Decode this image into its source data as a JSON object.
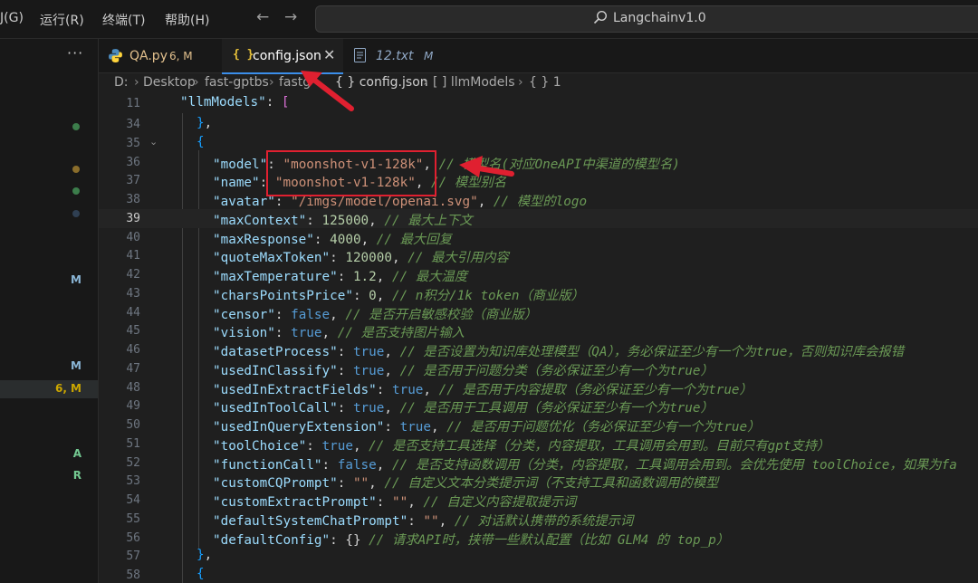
{
  "menu": [
    "运行(R)",
    "终端(T)",
    "帮助(H)"
  ],
  "menu_partial": "J(G)",
  "command_center": {
    "label": "Langchainv1.0",
    "icon": "search-icon"
  },
  "side_panel": {
    "badges": [
      {
        "text": "M",
        "color": "#8ab6d6"
      },
      {
        "text": "M",
        "color": "#8ab6d6"
      },
      {
        "text": "6, M",
        "color": "#cca700"
      },
      {
        "text": "A",
        "color": "#73c991"
      },
      {
        "text": "R",
        "color": "#73c991"
      }
    ],
    "dots": [
      {
        "color": "#3c7d4b"
      },
      {
        "color": "#8a6d2b"
      },
      {
        "color": "#3c7d4b"
      },
      {
        "color": "#2f3f52"
      }
    ]
  },
  "tabs": [
    {
      "label": "QA.py",
      "status": "6, M",
      "icon": "python-icon"
    },
    {
      "label": "config.json",
      "status": "",
      "icon": "json-braces-icon",
      "active": true
    },
    {
      "label": "12.txt",
      "status": "M",
      "icon": "text-file-icon"
    }
  ],
  "breadcrumb": [
    "D:",
    "Desktop",
    "fast-gptbs",
    "fastg",
    "{ } config.json",
    "[ ] llmModels",
    "{ } 1"
  ],
  "editor": {
    "current_line": "39",
    "sticky_line": {
      "num": "11",
      "key": "\"llmModels\"",
      "rest": ": ["
    },
    "lines": [
      {
        "num": "34",
        "text": "},"
      },
      {
        "num": "35",
        "text": "{"
      },
      {
        "num": "36",
        "key": "\"model\"",
        "val": "\"moonshot-v1-128k\"",
        "vtype": "s",
        "comment": "// 模型名(对应OneAPI中渠道的模型名)"
      },
      {
        "num": "37",
        "key": "\"name\"",
        "val": "\"moonshot-v1-128k\"",
        "vtype": "s",
        "comment": "// 模型别名"
      },
      {
        "num": "38",
        "key": "\"avatar\"",
        "val": "\"/imgs/model/openai.svg\"",
        "vtype": "s",
        "comment": "// 模型的logo"
      },
      {
        "num": "39",
        "key": "\"maxContext\"",
        "val": "125000",
        "vtype": "n",
        "comment": "// 最大上下文"
      },
      {
        "num": "40",
        "key": "\"maxResponse\"",
        "val": "4000",
        "vtype": "n",
        "comment": "// 最大回复"
      },
      {
        "num": "41",
        "key": "\"quoteMaxToken\"",
        "val": "120000",
        "vtype": "n",
        "comment": "// 最大引用内容"
      },
      {
        "num": "42",
        "key": "\"maxTemperature\"",
        "val": "1.2",
        "vtype": "n",
        "comment": "// 最大温度"
      },
      {
        "num": "43",
        "key": "\"charsPointsPrice\"",
        "val": "0",
        "vtype": "n",
        "comment": "// n积分/1k token（商业版）"
      },
      {
        "num": "44",
        "key": "\"censor\"",
        "val": "false",
        "vtype": "b",
        "comment": "// 是否开启敏感校验（商业版）"
      },
      {
        "num": "45",
        "key": "\"vision\"",
        "val": "true",
        "vtype": "b",
        "comment": "// 是否支持图片输入"
      },
      {
        "num": "46",
        "key": "\"datasetProcess\"",
        "val": "true",
        "vtype": "b",
        "comment": "// 是否设置为知识库处理模型（QA），务必保证至少有一个为true，否则知识库会报错"
      },
      {
        "num": "47",
        "key": "\"usedInClassify\"",
        "val": "true",
        "vtype": "b",
        "comment": "// 是否用于问题分类（务必保证至少有一个为true）"
      },
      {
        "num": "48",
        "key": "\"usedInExtractFields\"",
        "val": "true",
        "vtype": "b",
        "comment": "// 是否用于内容提取（务必保证至少有一个为true）"
      },
      {
        "num": "49",
        "key": "\"usedInToolCall\"",
        "val": "true",
        "vtype": "b",
        "comment": "// 是否用于工具调用（务必保证至少有一个为true）"
      },
      {
        "num": "50",
        "key": "\"usedInQueryExtension\"",
        "val": "true",
        "vtype": "b",
        "comment": "// 是否用于问题优化（务必保证至少有一个为true）"
      },
      {
        "num": "51",
        "key": "\"toolChoice\"",
        "val": "true",
        "vtype": "b",
        "comment": "// 是否支持工具选择（分类，内容提取，工具调用会用到。目前只有gpt支持）"
      },
      {
        "num": "52",
        "key": "\"functionCall\"",
        "val": "false",
        "vtype": "b",
        "comment": "// 是否支持函数调用（分类，内容提取，工具调用会用到。会优先使用 toolChoice，如果为fa"
      },
      {
        "num": "53",
        "key": "\"customCQPrompt\"",
        "val": "\"\"",
        "vtype": "s",
        "comment": "// 自定义文本分类提示词（不支持工具和函数调用的模型"
      },
      {
        "num": "54",
        "key": "\"customExtractPrompt\"",
        "val": "\"\"",
        "vtype": "s",
        "comment": "// 自定义内容提取提示词"
      },
      {
        "num": "55",
        "key": "\"defaultSystemChatPrompt\"",
        "val": "\"\"",
        "vtype": "s",
        "comment": "// 对话默认携带的系统提示词"
      },
      {
        "num": "56",
        "key": "\"defaultConfig\"",
        "val": "{}",
        "vtype": "p",
        "comment": "// 请求API时，挟带一些默认配置（比如 GLM4 的 top_p）",
        "nocomma": true
      },
      {
        "num": "57",
        "text": "},"
      },
      {
        "num": "58",
        "text": "{"
      }
    ]
  },
  "colors": {
    "accent": "#3b8eea",
    "annotation": "#e02030"
  }
}
